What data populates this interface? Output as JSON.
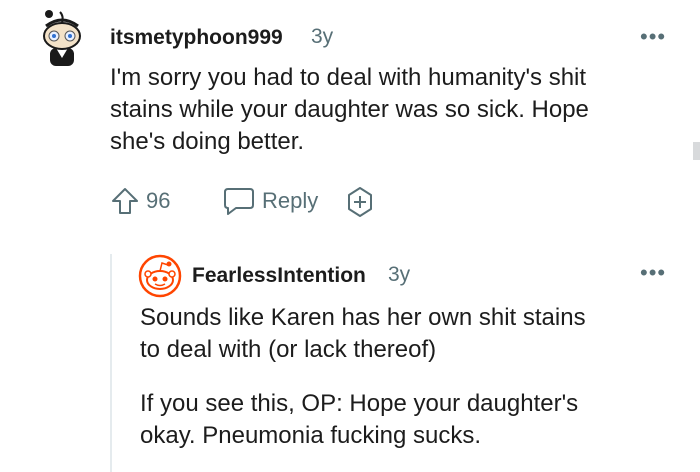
{
  "comment1": {
    "username": "itsmetyphoon999",
    "age": "3y",
    "body": [
      "I'm sorry you had to deal with humanity's shit",
      "stains while your daughter was so sick. Hope",
      "she's doing better."
    ],
    "upvotes": "96",
    "reply_label": "Reply",
    "more_label": "•••"
  },
  "comment2": {
    "username": "FearlessIntention",
    "age": "3y",
    "paragraph1": [
      "Sounds like Karen has her own shit stains",
      "to deal with (or lack thereof)"
    ],
    "paragraph2": [
      "If you see this, OP: Hope your daughter's",
      "okay. Pneumonia fucking sucks."
    ],
    "more_label": "•••"
  },
  "icons": [
    "avatar-icon",
    "upvote-icon",
    "reply-icon",
    "award-icon",
    "more-icon"
  ],
  "colors": {
    "text": "#1c1c1c",
    "meta": "#576f76",
    "snoo_orange": "#ff4500"
  }
}
